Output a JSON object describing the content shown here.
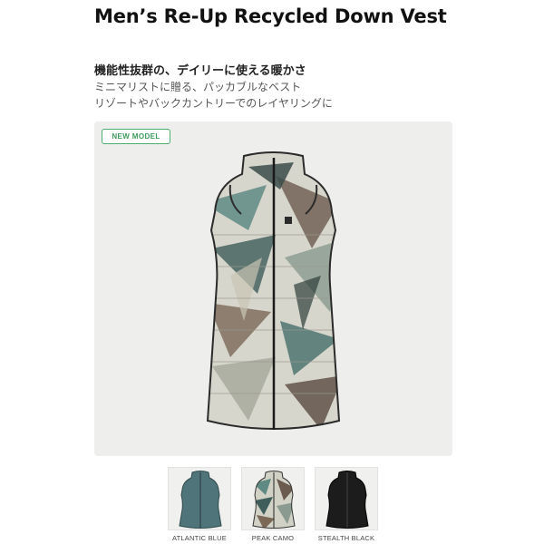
{
  "product": {
    "title": "Men’s Re-Up Recycled Down Vest",
    "catchphrase": "機能性抜群の、デイリーに使える暖かさ",
    "sub_lines": [
      "ミニマリストに贈る、パッカブルなベスト",
      "リゾートやバックカントリーでのレイヤリングに"
    ]
  },
  "image_panel": {
    "badge": "NEW MODEL",
    "image_icon": "vest-peak-camo-front"
  },
  "swatches": [
    {
      "label": "ATLANTIC BLUE",
      "color": "#4f7479",
      "icon": "vest-atlantic-blue"
    },
    {
      "label": "PEAK CAMO",
      "color": "#9aa59b",
      "icon": "vest-peak-camo"
    },
    {
      "label": "STEALTH BLACK",
      "color": "#1c1c1c",
      "icon": "vest-stealth-black"
    }
  ],
  "colors": {
    "badge_green": "#3d9a5d",
    "panel_bg": "#eeeeec"
  }
}
